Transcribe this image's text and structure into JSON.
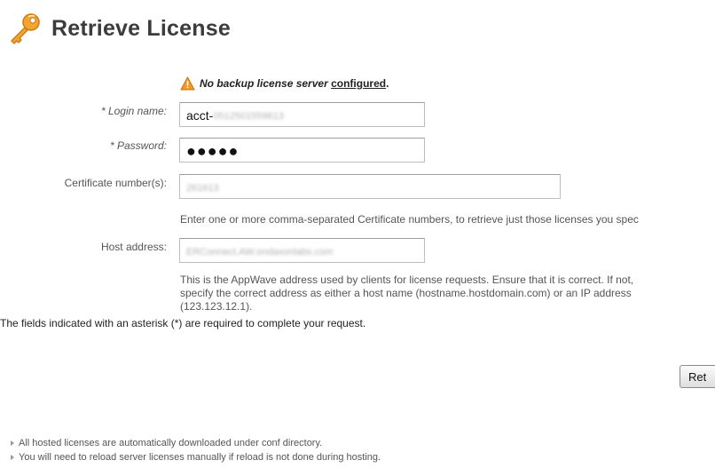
{
  "header": {
    "title": "Retrieve License",
    "icon": "key-icon",
    "icon_color": "#f0a030"
  },
  "warning": {
    "icon": "warning-icon",
    "text_before": "No backup license server ",
    "link_text": "configured",
    "text_after": "."
  },
  "form": {
    "login_name": {
      "label": "* Login name:",
      "value_prefix": "acct-",
      "value_obscured": "0512501559613"
    },
    "password": {
      "label": "* Password:",
      "value_masked": "●●●●●"
    },
    "certificate_numbers": {
      "label": "Certificate number(s):",
      "value_obscured": "261613",
      "help": "Enter one or more comma-separated Certificate numbers, to retrieve just those licenses you spec"
    },
    "host_address": {
      "label": "Host address:",
      "value_obscured": "ERConnect.AW.ondaxonlabs.com",
      "help_lines": [
        "This is the AppWave address used by clients for license requests. Ensure that it is correct. If not,",
        "specify the correct address as either a host name (hostname.hostdomain.com) or an IP address",
        "(123.123.12.1)."
      ]
    },
    "required_note": "The fields indicated with an asterisk (*) are required to complete your request."
  },
  "actions": {
    "retrieve_label": "Ret"
  },
  "notes": [
    "All hosted licenses are automatically downloaded under conf directory.",
    "You will need to reload server licenses manually if reload is not done during hosting."
  ]
}
